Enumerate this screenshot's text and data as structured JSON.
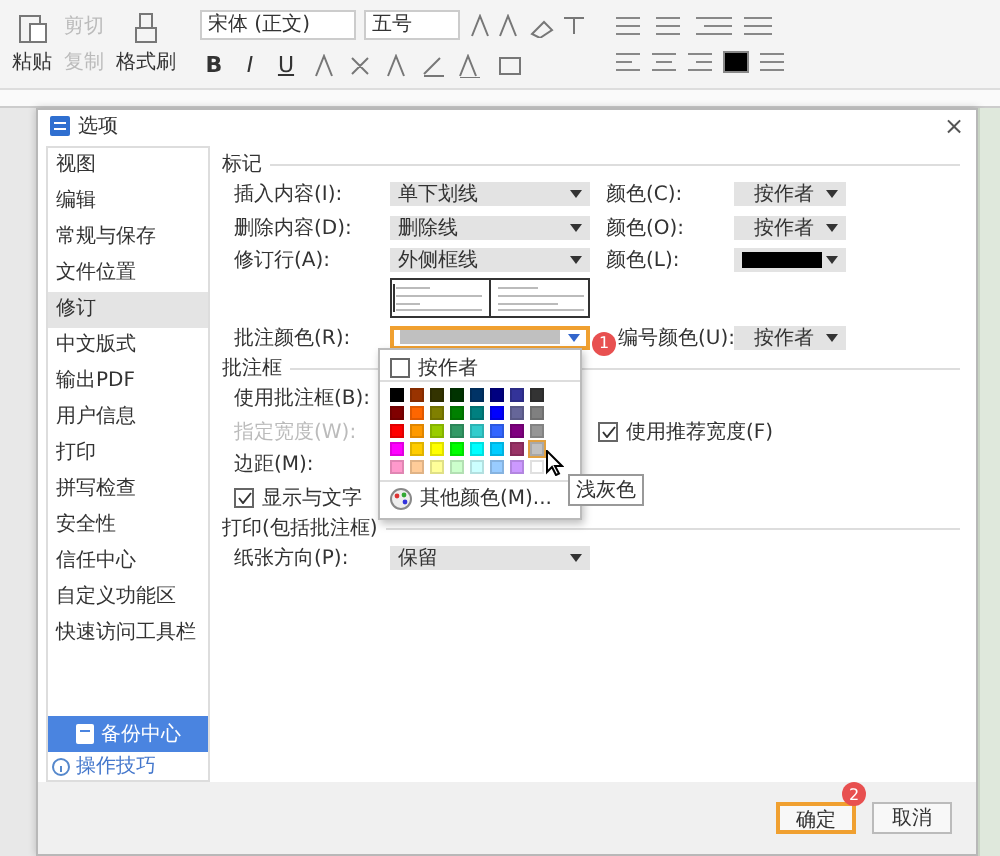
{
  "ribbon": {
    "paste": "粘贴",
    "cut": {
      "label": "剪切",
      "disabled": true
    },
    "copy": {
      "label": "复制",
      "disabled": true
    },
    "format_painter": "格式刷",
    "font": "宋体 (正文)",
    "font_size": "五号",
    "styles": [
      "B",
      "I",
      "U"
    ]
  },
  "dialog": {
    "title": "选项",
    "close": "×"
  },
  "sidebar": {
    "items": [
      {
        "label": "视图",
        "selected": false
      },
      {
        "label": "编辑",
        "selected": false
      },
      {
        "label": "常规与保存",
        "selected": false
      },
      {
        "label": "文件位置",
        "selected": false
      },
      {
        "label": "修订",
        "selected": true
      },
      {
        "label": "中文版式",
        "selected": false
      },
      {
        "label": "输出PDF",
        "selected": false
      },
      {
        "label": "用户信息",
        "selected": false
      },
      {
        "label": "打印",
        "selected": false
      },
      {
        "label": "拼写检查",
        "selected": false
      },
      {
        "label": "安全性",
        "selected": false
      },
      {
        "label": "信任中心",
        "selected": false
      },
      {
        "label": "自定义功能区",
        "selected": false
      },
      {
        "label": "快速访问工具栏",
        "selected": false
      }
    ],
    "backup": "备份中心",
    "tips": "操作技巧"
  },
  "marks": {
    "title": "标记",
    "rows": [
      {
        "label": "插入内容(I):",
        "value": "单下划线",
        "color_label": "颜色(C):",
        "kind": "text",
        "color_value": "按作者"
      },
      {
        "label": "删除内容(D):",
        "value": "删除线",
        "color_label": "颜色(O):",
        "kind": "text",
        "color_value": "按作者"
      },
      {
        "label": "修订行(A):",
        "value": "外侧框线",
        "color_label": "颜色(L):",
        "kind": "swatch",
        "color": "#000000"
      }
    ]
  },
  "comment_color": {
    "label": "批注颜色(R):",
    "highlighted": true,
    "badge": "1",
    "number_label": "编号颜色(U):",
    "number_value": "按作者"
  },
  "comment_box": {
    "title": "批注框",
    "use_label": "使用批注框(B):",
    "width_label": "指定宽度(W):",
    "width_disabled": true,
    "margin_label": "边距(M):",
    "show_lines": {
      "label": "显示与文字",
      "checked": true
    },
    "recommended": {
      "label": "使用推荐宽度(F)",
      "checked": true
    }
  },
  "print": {
    "title": "打印(包括批注框)",
    "orientation_label": "纸张方向(P):",
    "orientation_value": "保留"
  },
  "color_menu": {
    "by_author": {
      "label": "按作者",
      "checked": false
    },
    "more": "其他颜色(M)...",
    "tooltip": "浅灰色",
    "swatches": [
      {
        "color": "#000000",
        "hovered": false
      },
      {
        "color": "#993300",
        "hovered": false
      },
      {
        "color": "#333300",
        "hovered": false
      },
      {
        "color": "#003300",
        "hovered": false
      },
      {
        "color": "#003366",
        "hovered": false
      },
      {
        "color": "#000080",
        "hovered": false
      },
      {
        "color": "#333399",
        "hovered": false
      },
      {
        "color": "#333333",
        "hovered": false
      },
      {
        "color": "#800000",
        "hovered": false
      },
      {
        "color": "#ff6600",
        "hovered": false
      },
      {
        "color": "#808000",
        "hovered": false
      },
      {
        "color": "#008000",
        "hovered": false
      },
      {
        "color": "#008080",
        "hovered": false
      },
      {
        "color": "#0000ff",
        "hovered": false
      },
      {
        "color": "#666699",
        "hovered": false
      },
      {
        "color": "#808080",
        "hovered": false
      },
      {
        "color": "#ff0000",
        "hovered": false
      },
      {
        "color": "#ff9900",
        "hovered": false
      },
      {
        "color": "#99cc00",
        "hovered": false
      },
      {
        "color": "#339966",
        "hovered": false
      },
      {
        "color": "#33cccc",
        "hovered": false
      },
      {
        "color": "#3366ff",
        "hovered": false
      },
      {
        "color": "#800080",
        "hovered": false
      },
      {
        "color": "#969696",
        "hovered": false
      },
      {
        "color": "#ff00ff",
        "hovered": false
      },
      {
        "color": "#ffcc00",
        "hovered": false
      },
      {
        "color": "#ffff00",
        "hovered": false
      },
      {
        "color": "#00ff00",
        "hovered": false
      },
      {
        "color": "#00ffff",
        "hovered": false
      },
      {
        "color": "#00ccff",
        "hovered": false
      },
      {
        "color": "#993366",
        "hovered": false
      },
      {
        "color": "#c0c0c0",
        "hovered": true
      },
      {
        "color": "#ff99cc",
        "hovered": false
      },
      {
        "color": "#ffcc99",
        "hovered": false
      },
      {
        "color": "#ffff99",
        "hovered": false
      },
      {
        "color": "#ccffcc",
        "hovered": false
      },
      {
        "color": "#ccffff",
        "hovered": false
      },
      {
        "color": "#99ccff",
        "hovered": false
      },
      {
        "color": "#cc99ff",
        "hovered": false
      },
      {
        "color": "#ffffff",
        "hovered": false
      }
    ]
  },
  "buttons": [
    {
      "label": "确定",
      "highlighted": true,
      "badge": "2"
    },
    {
      "label": "取消",
      "highlighted": false
    }
  ]
}
